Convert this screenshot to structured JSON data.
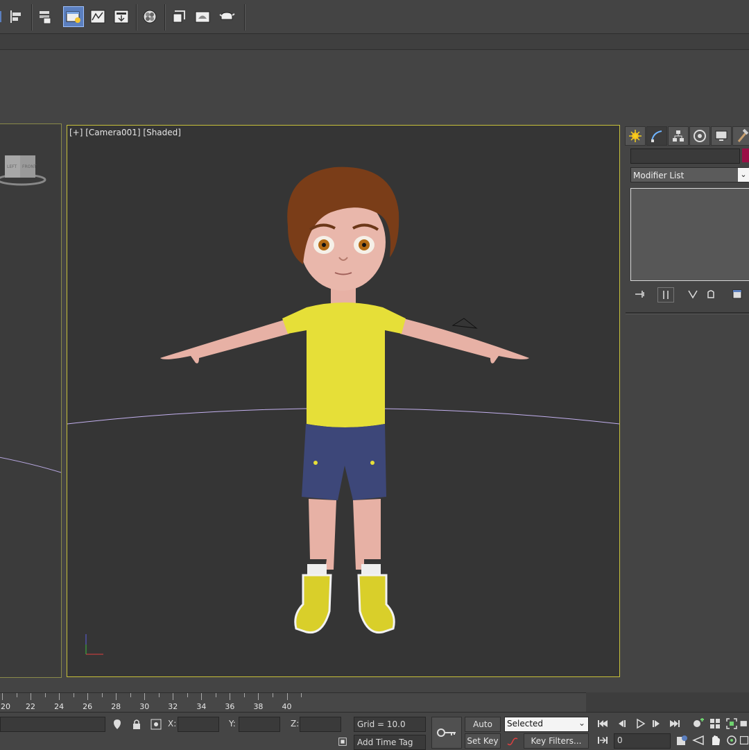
{
  "viewport": {
    "label": "[+] [Camera001] [Shaded]"
  },
  "view_cube": {
    "left_face": "LEFT",
    "front_face": "FRONT"
  },
  "command_panel": {
    "modifier_list": "Modifier List",
    "modifier_list_arrow": "⌄",
    "object_color": "#9a0f45"
  },
  "timeline": {
    "ticks": [
      "20",
      "22",
      "24",
      "26",
      "28",
      "30",
      "32",
      "34",
      "36",
      "38",
      "40"
    ]
  },
  "status_bar": {
    "x_label": "X:",
    "y_label": "Y:",
    "z_label": "Z:",
    "grid": "Grid = 10.0",
    "add_time_tag": "Add Time Tag",
    "auto_key": "Auto Key",
    "set_key": "Set Key",
    "key_mode_selected": "Selected",
    "key_filters": "Key Filters...",
    "current_frame": "0"
  },
  "colors": {
    "viewport_border_active": "#c8c23a",
    "shirt": "#e8e03a",
    "shorts": "#3b4677",
    "skin": "#e7b1a5",
    "hair": "#7a3d18",
    "shoes": "#d9cf2a"
  }
}
